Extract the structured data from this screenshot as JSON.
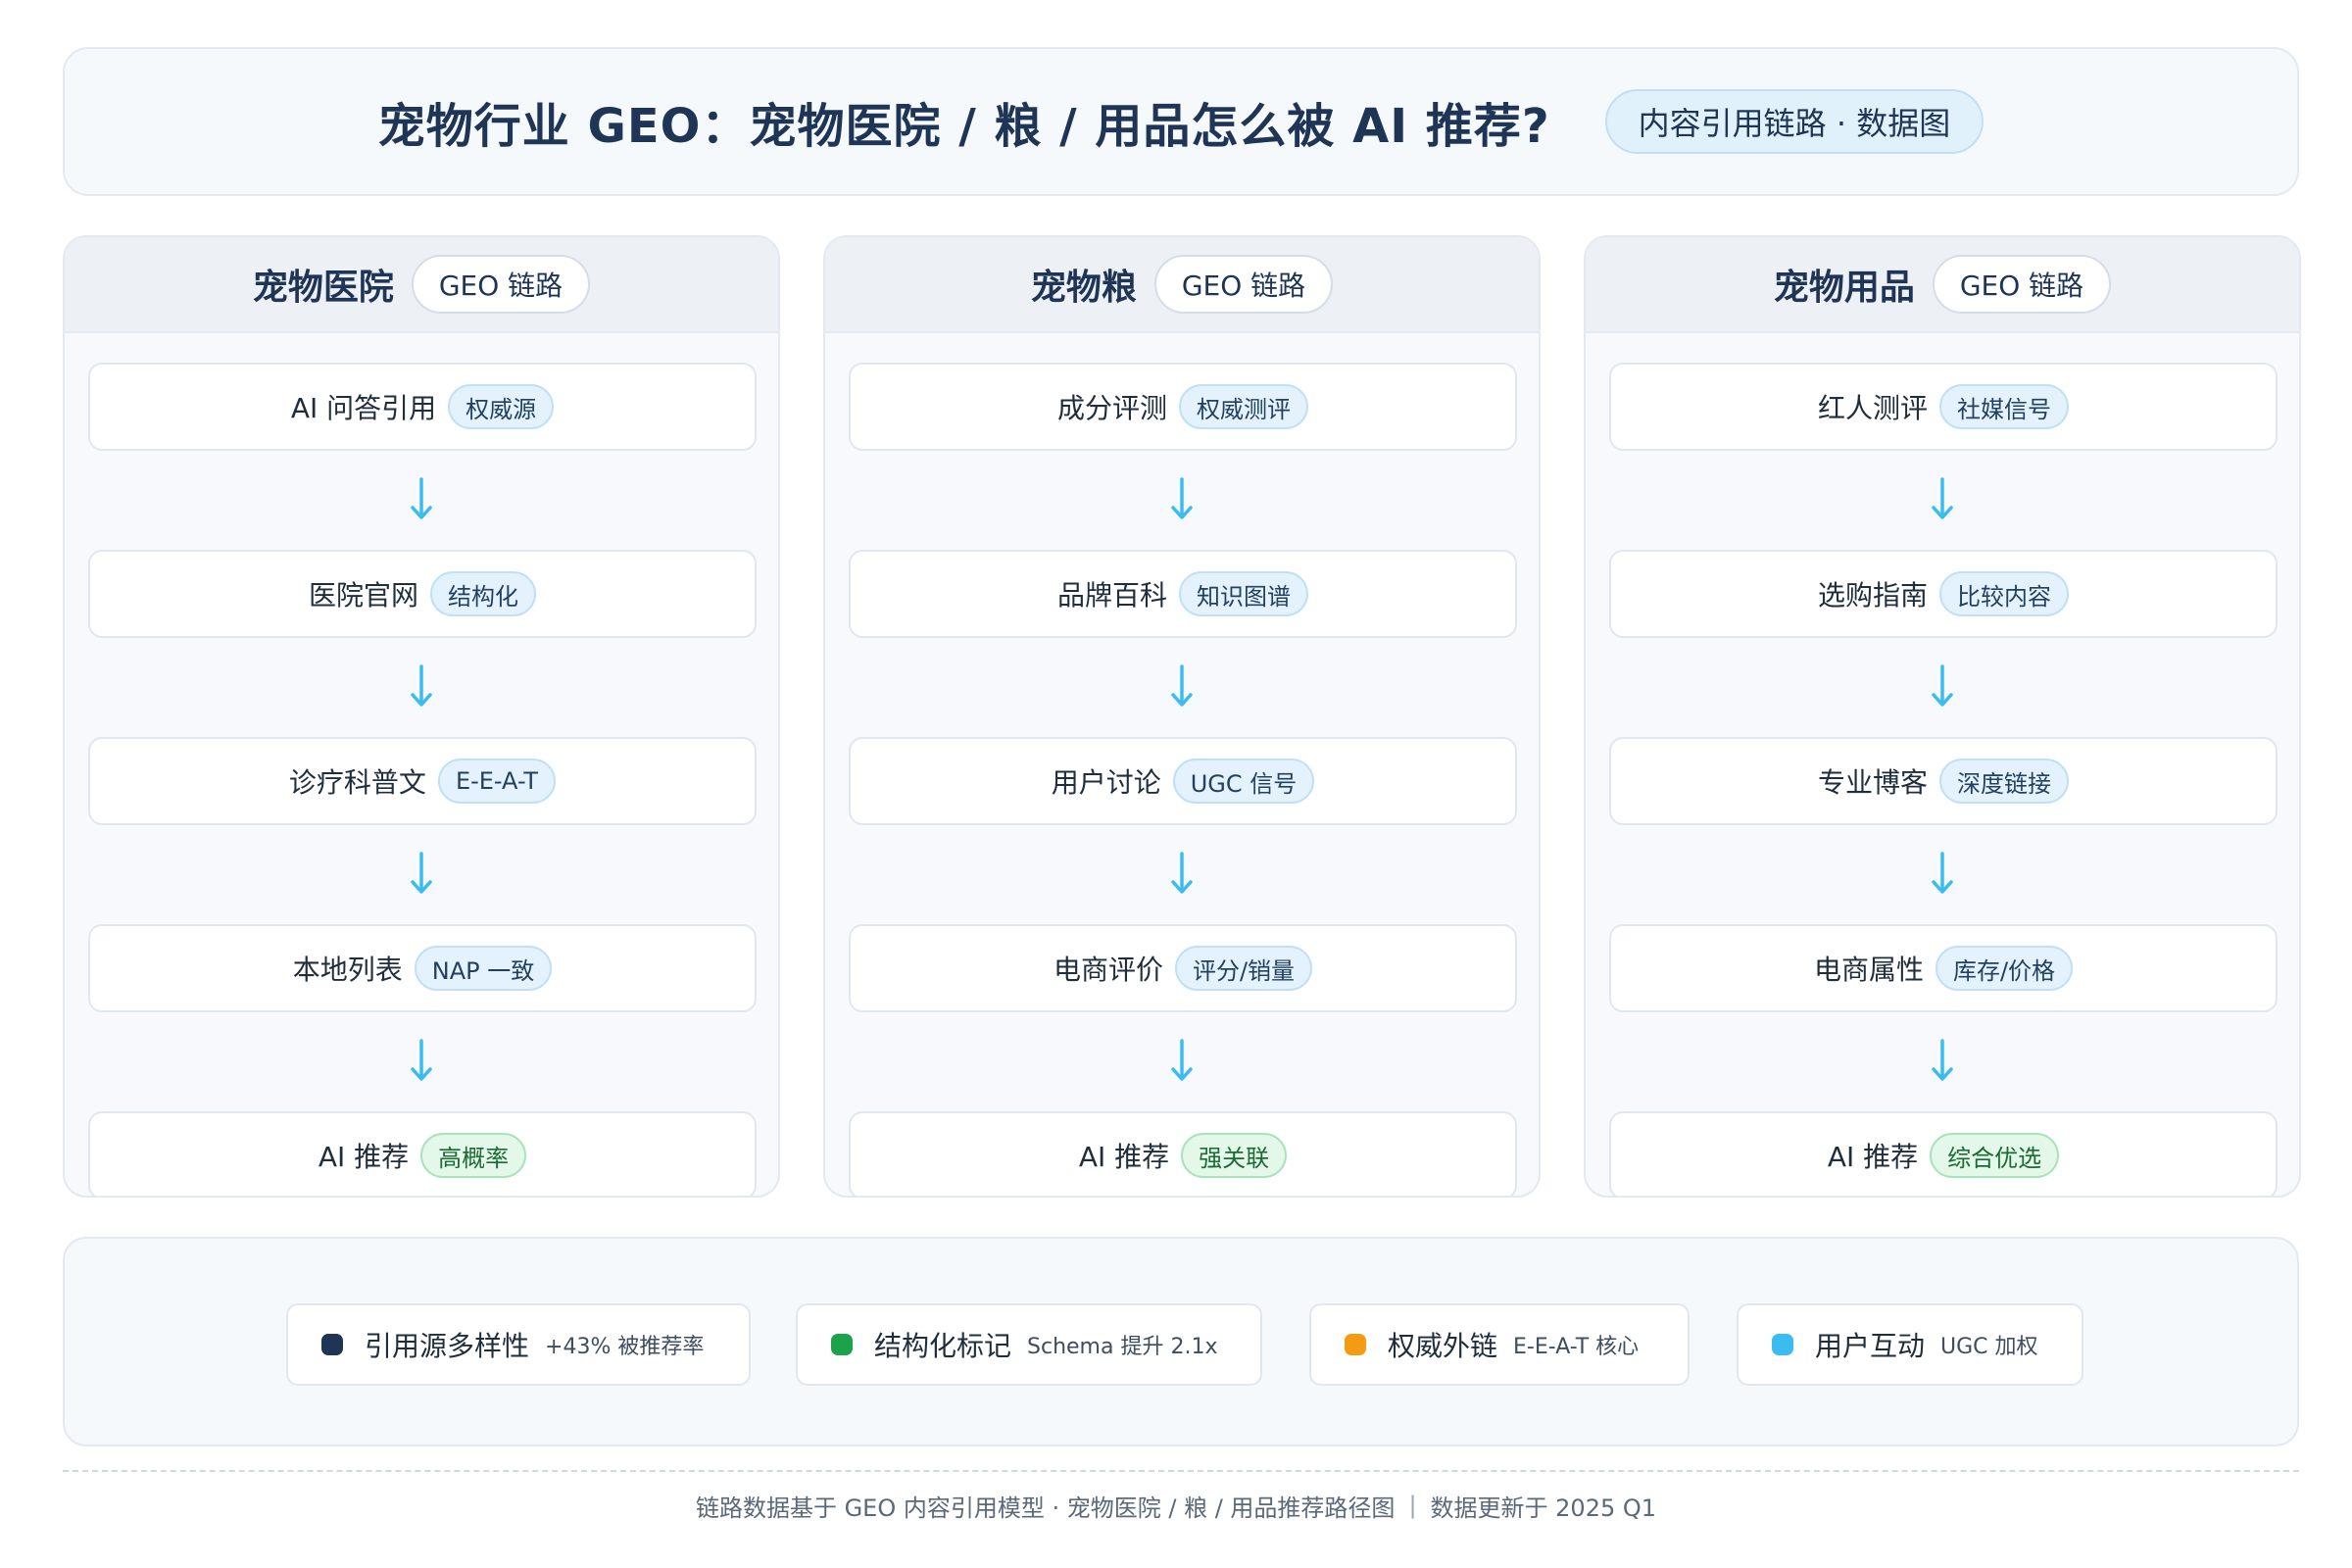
{
  "header": {
    "title": "宠物行业 GEO：宠物医院 / 粮 / 用品怎么被 AI 推荐?",
    "badge": "内容引用链路 · 数据图"
  },
  "columns": [
    {
      "title": "宠物医院",
      "pill": "GEO 链路",
      "steps": [
        {
          "label": "AI 问答引用",
          "tag": "权威源",
          "tag_style": "blue"
        },
        {
          "label": "医院官网",
          "tag": "结构化",
          "tag_style": "blue"
        },
        {
          "label": "诊疗科普文",
          "tag": "E-E-A-T",
          "tag_style": "blue"
        },
        {
          "label": "本地列表",
          "tag": "NAP 一致",
          "tag_style": "blue"
        },
        {
          "label": "AI 推荐",
          "tag": "高概率",
          "tag_style": "green"
        }
      ]
    },
    {
      "title": "宠物粮",
      "pill": "GEO 链路",
      "steps": [
        {
          "label": "成分评测",
          "tag": "权威测评",
          "tag_style": "blue"
        },
        {
          "label": "品牌百科",
          "tag": "知识图谱",
          "tag_style": "blue"
        },
        {
          "label": "用户讨论",
          "tag": "UGC 信号",
          "tag_style": "blue"
        },
        {
          "label": "电商评价",
          "tag": "评分/销量",
          "tag_style": "blue"
        },
        {
          "label": "AI 推荐",
          "tag": "强关联",
          "tag_style": "green"
        }
      ]
    },
    {
      "title": "宠物用品",
      "pill": "GEO 链路",
      "steps": [
        {
          "label": "红人测评",
          "tag": "社媒信号",
          "tag_style": "blue"
        },
        {
          "label": "选购指南",
          "tag": "比较内容",
          "tag_style": "blue"
        },
        {
          "label": "专业博客",
          "tag": "深度链接",
          "tag_style": "blue"
        },
        {
          "label": "电商属性",
          "tag": "库存/价格",
          "tag_style": "blue"
        },
        {
          "label": "AI 推荐",
          "tag": "综合优选",
          "tag_style": "green"
        }
      ]
    }
  ],
  "legend": [
    {
      "label": "引用源多样性",
      "sub": "+43% 被推荐率",
      "color": "#1e3556"
    },
    {
      "label": "结构化标记",
      "sub": "Schema 提升 2.1x",
      "color": "#1aa34a"
    },
    {
      "label": "权威外链",
      "sub": "E-E-A-T 核心",
      "color": "#f39c12"
    },
    {
      "label": "用户互动",
      "sub": "UGC 加权",
      "color": "#3bbcf0"
    }
  ],
  "footer": {
    "left": "链路数据基于 GEO 内容引用模型 · 宠物医院 / 粮 / 用品推荐路径图",
    "separator": "|",
    "right": "数据更新于 2025 Q1"
  },
  "colors": {
    "title": "#1e3556",
    "arrow": "#3bbcf0",
    "tag_blue_bg": "#e3f2fc",
    "tag_green_bg": "#e3f8e9"
  }
}
